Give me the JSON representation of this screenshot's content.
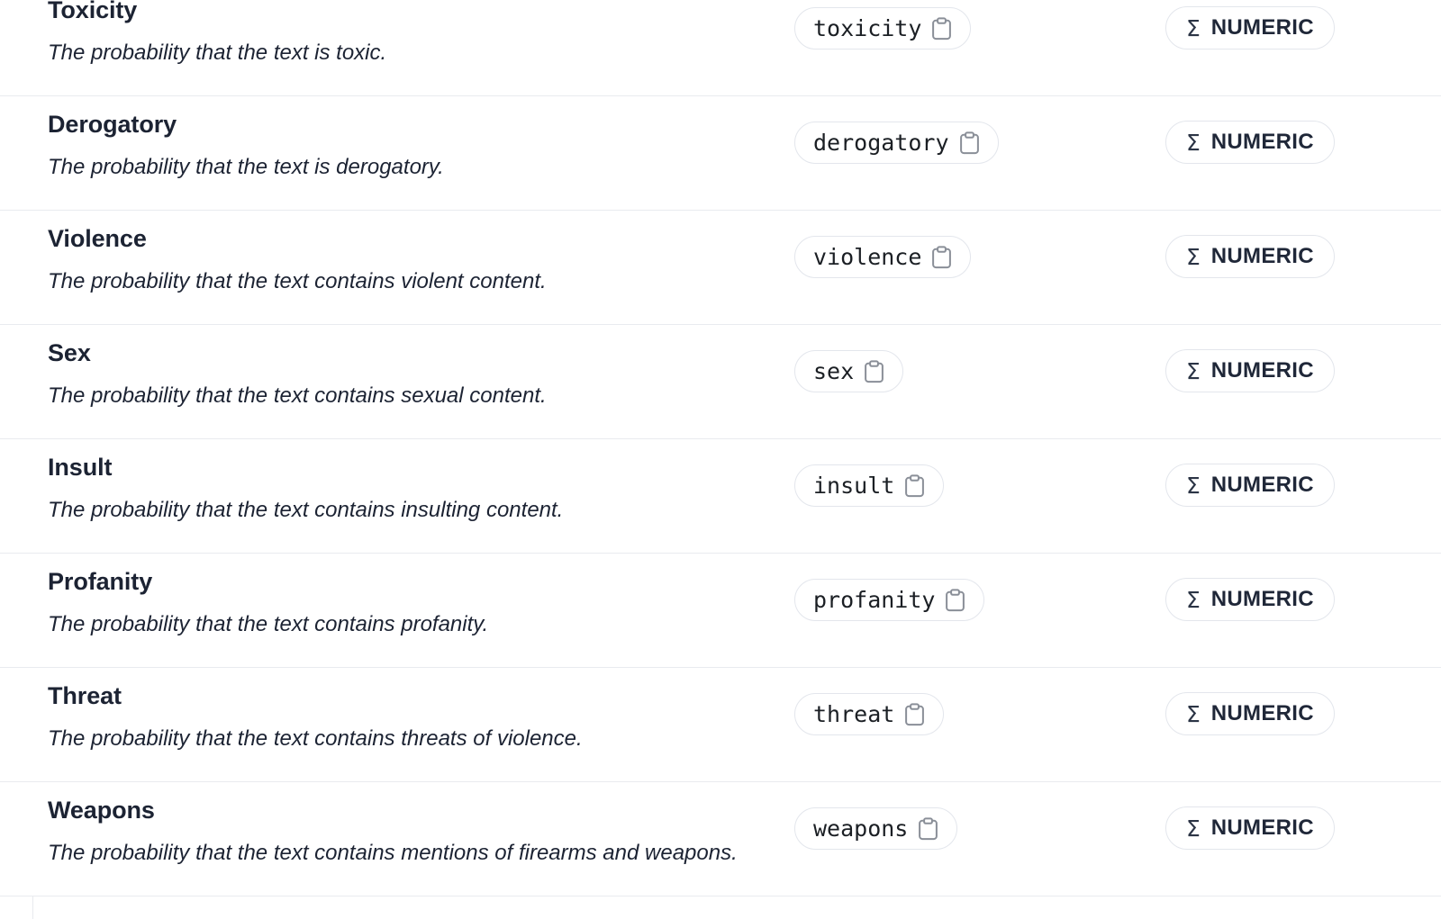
{
  "panel": {
    "name": "schema-field-list",
    "type_icon": "sigma-icon",
    "copy_icon": "clipboard-icon",
    "border_color": "#e9ebef",
    "chip_border_color": "#e3e6ec",
    "title_color": "#1c2333"
  },
  "rows": [
    {
      "title": "Toxicity",
      "description": "The probability that the text is toxic.",
      "key": "toxicity",
      "type": "NUMERIC",
      "type_symbol": "Σ"
    },
    {
      "title": "Derogatory",
      "description": "The probability that the text is derogatory.",
      "key": "derogatory",
      "type": "NUMERIC",
      "type_symbol": "Σ"
    },
    {
      "title": "Violence",
      "description": "The probability that the text contains violent content.",
      "key": "violence",
      "type": "NUMERIC",
      "type_symbol": "Σ"
    },
    {
      "title": "Sex",
      "description": "The probability that the text contains sexual content.",
      "key": "sex",
      "type": "NUMERIC",
      "type_symbol": "Σ"
    },
    {
      "title": "Insult",
      "description": "The probability that the text contains insulting content.",
      "key": "insult",
      "type": "NUMERIC",
      "type_symbol": "Σ"
    },
    {
      "title": "Profanity",
      "description": "The probability that the text contains profanity.",
      "key": "profanity",
      "type": "NUMERIC",
      "type_symbol": "Σ"
    },
    {
      "title": "Threat",
      "description": "The probability that the text contains threats of violence.",
      "key": "threat",
      "type": "NUMERIC",
      "type_symbol": "Σ"
    },
    {
      "title": "Weapons",
      "description": "The probability that the text contains mentions of firearms and weapons.",
      "key": "weapons",
      "type": "NUMERIC",
      "type_symbol": "Σ"
    }
  ]
}
